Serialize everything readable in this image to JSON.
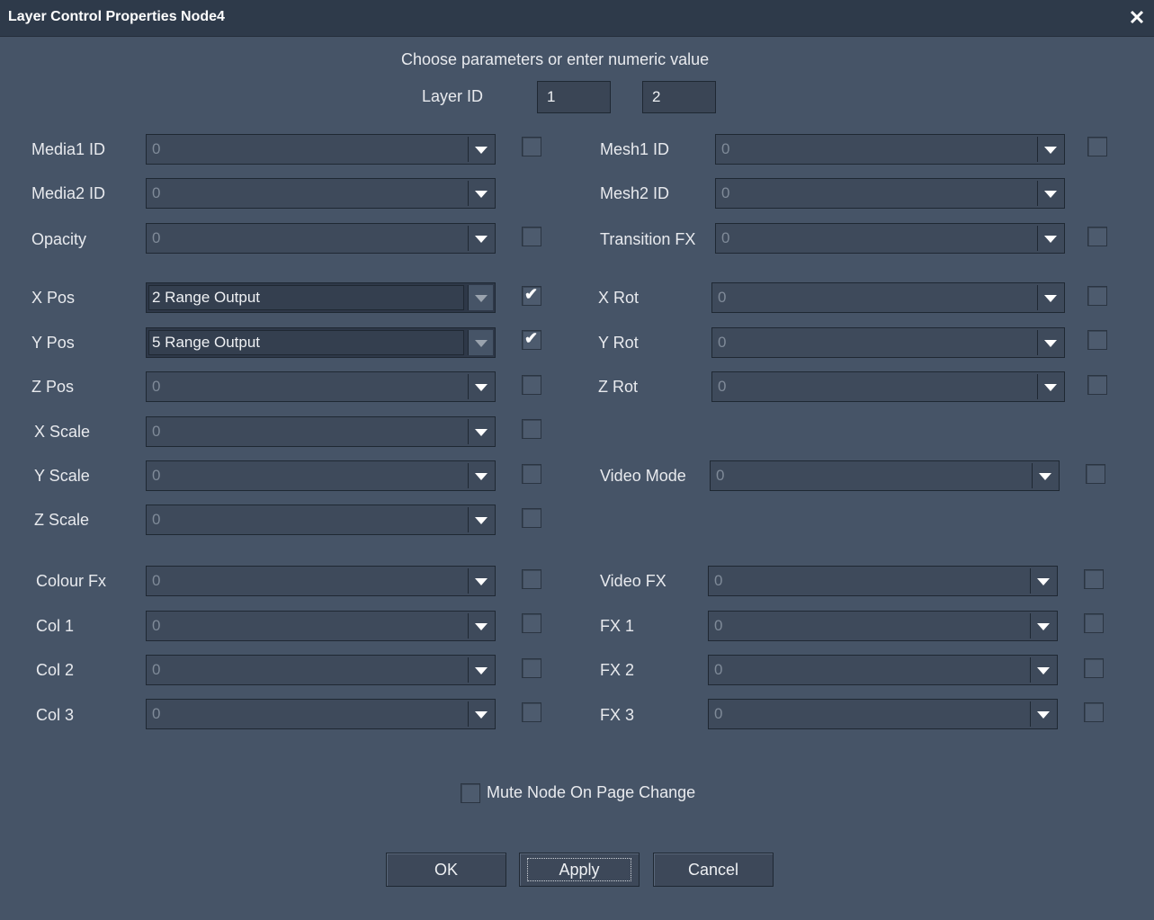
{
  "window": {
    "title": "Layer Control Properties Node4"
  },
  "header": {
    "instruction": "Choose parameters or enter numeric value",
    "layer_id_label": "Layer ID",
    "layer_id_1": "1",
    "layer_id_2": "2"
  },
  "left": {
    "media1": {
      "label": "Media1 ID",
      "value": "0"
    },
    "media2": {
      "label": "Media2 ID",
      "value": "0"
    },
    "opacity": {
      "label": "Opacity",
      "value": "0"
    },
    "xpos": {
      "label": "X Pos",
      "value": "2 Range Output"
    },
    "ypos": {
      "label": "Y Pos",
      "value": "5 Range Output"
    },
    "zpos": {
      "label": "Z Pos",
      "value": "0"
    },
    "xscale": {
      "label": "X Scale",
      "value": "0"
    },
    "yscale": {
      "label": "Y Scale",
      "value": "0"
    },
    "zscale": {
      "label": "Z Scale",
      "value": "0"
    },
    "colourfx": {
      "label": "Colour Fx",
      "value": "0"
    },
    "col1": {
      "label": "Col 1",
      "value": "0"
    },
    "col2": {
      "label": "Col 2",
      "value": "0"
    },
    "col3": {
      "label": "Col 3",
      "value": "0"
    }
  },
  "right": {
    "mesh1": {
      "label": "Mesh1 ID",
      "value": "0"
    },
    "mesh2": {
      "label": "Mesh2 ID",
      "value": "0"
    },
    "transition": {
      "label": "Transition FX",
      "value": "0"
    },
    "xrot": {
      "label": "X Rot",
      "value": "0"
    },
    "yrot": {
      "label": "Y Rot",
      "value": "0"
    },
    "zrot": {
      "label": "Z Rot",
      "value": "0"
    },
    "videomode": {
      "label": "Video Mode",
      "value": "0"
    },
    "videofx": {
      "label": "Video FX",
      "value": "0"
    },
    "fx1": {
      "label": "FX 1",
      "value": "0"
    },
    "fx2": {
      "label": "FX 2",
      "value": "0"
    },
    "fx3": {
      "label": "FX 3",
      "value": "0"
    }
  },
  "checks": {
    "xpos": true,
    "ypos": true,
    "checkmark": "✔"
  },
  "footer": {
    "mute_label": "Mute Node On Page Change",
    "ok": "OK",
    "apply": "Apply",
    "cancel": "Cancel"
  },
  "colors": {
    "background": "#465467",
    "titlebar": "#2e3a4a"
  }
}
